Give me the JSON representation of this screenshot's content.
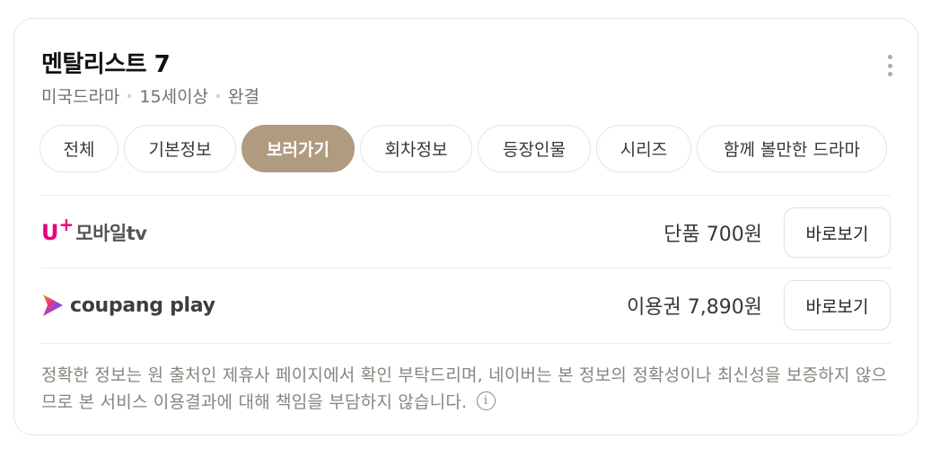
{
  "title": "멘탈리스트 7",
  "meta": [
    "미국드라마",
    "15세이상",
    "완결"
  ],
  "tabs": [
    {
      "label": "전체",
      "active": false
    },
    {
      "label": "기본정보",
      "active": false
    },
    {
      "label": "보러가기",
      "active": true
    },
    {
      "label": "회차정보",
      "active": false
    },
    {
      "label": "등장인물",
      "active": false
    },
    {
      "label": "시리즈",
      "active": false
    },
    {
      "label": "함께 볼만한 드라마",
      "active": false
    }
  ],
  "providers": [
    {
      "logo_text_u": "U",
      "logo_text_plus": "+",
      "logo_text": "모바일tv",
      "price": "단품 700원",
      "button": "바로보기"
    },
    {
      "logo_text": "coupang play",
      "price": "이용권 7,890원",
      "button": "바로보기"
    }
  ],
  "notice": "정확한 정보는 원 출처인 제휴사 페이지에서 확인 부탁드리며, 네이버는 본 정보의 정확성이나 최신성을 보증하지 않으므로 본 서비스 이용결과에 대해 책임을 부담하지 않습니다.",
  "icons": {
    "more": "more-vertical-icon",
    "info": "info-icon"
  },
  "colors": {
    "accent": "#b09a80",
    "uplus": "#e6007e"
  }
}
